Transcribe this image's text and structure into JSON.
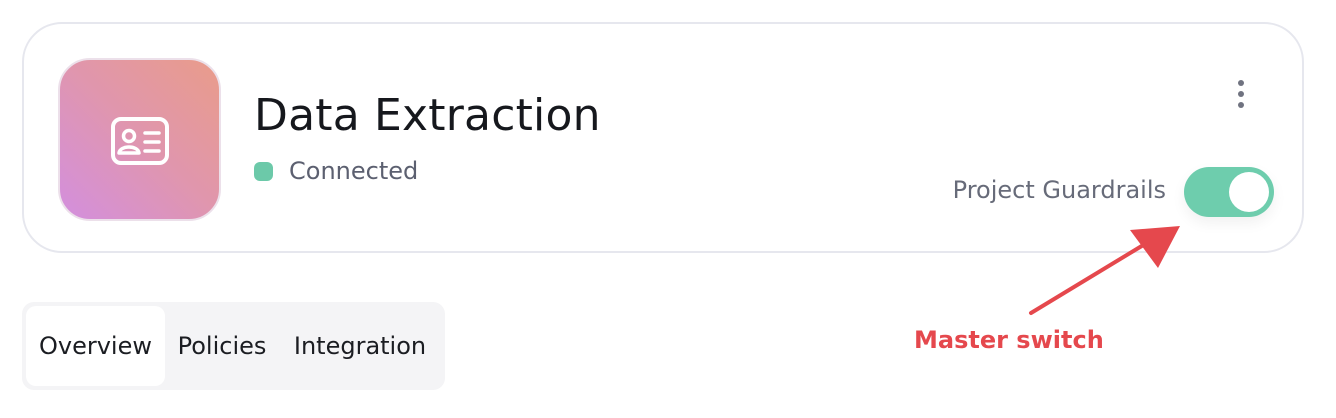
{
  "project": {
    "title": "Data Extraction",
    "status": "Connected",
    "status_color": "#6cc9a9",
    "icon": "id-card-icon"
  },
  "card_actions": {
    "more_icon": "more-vertical-icon"
  },
  "guardrails": {
    "label": "Project Guardrails",
    "enabled": true,
    "toggle_color": "#6ecdad"
  },
  "tabs": [
    {
      "label": "Overview",
      "active": true
    },
    {
      "label": "Policies",
      "active": false
    },
    {
      "label": "Integration",
      "active": false
    }
  ],
  "annotation": {
    "label": "Master switch",
    "color": "#e5484d"
  }
}
